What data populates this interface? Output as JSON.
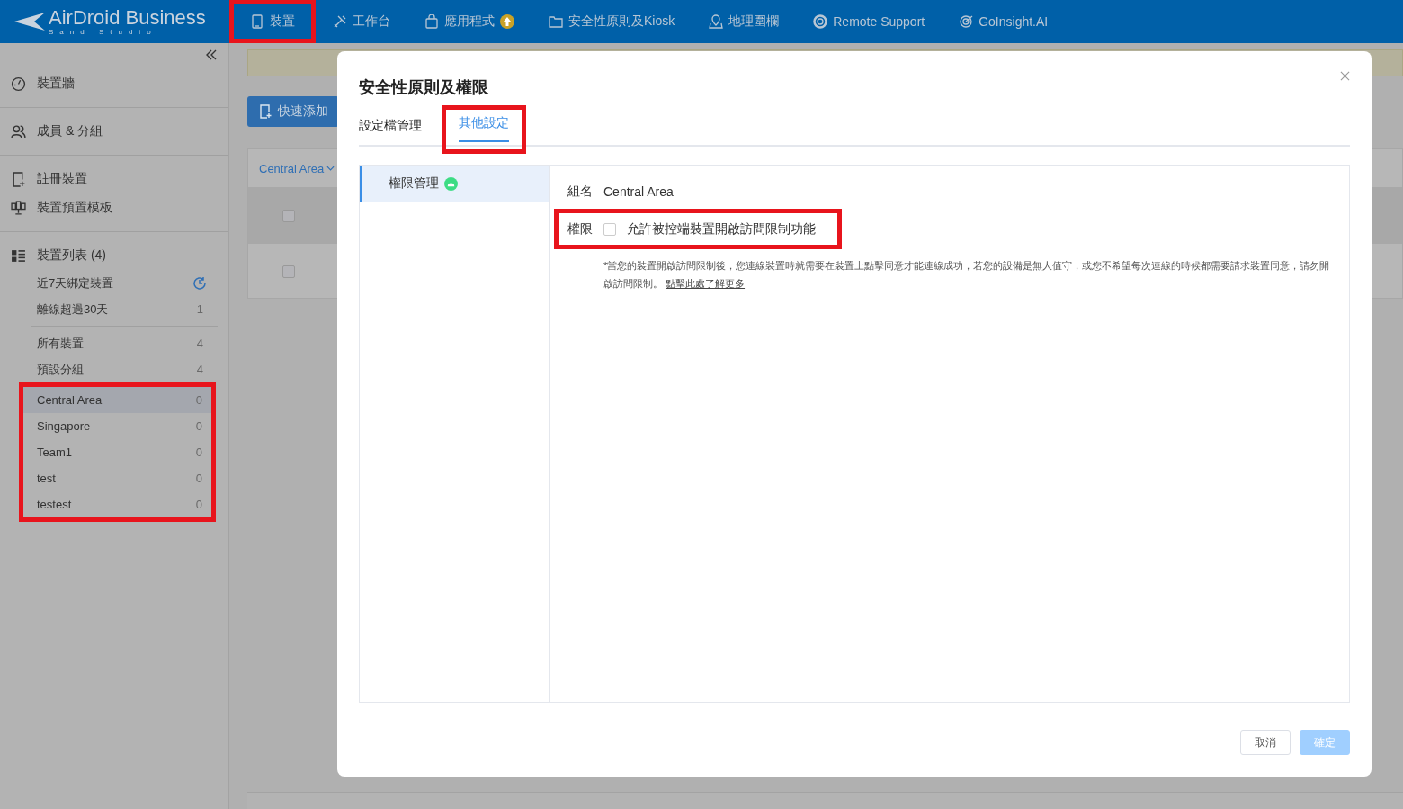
{
  "nav": {
    "logo": "AirDroid Business",
    "logo_sub": "Sand Studio",
    "items": [
      {
        "label": "裝置",
        "highlighted": true
      },
      {
        "label": "工作台",
        "highlighted": false
      },
      {
        "label": "應用程式",
        "badge": true,
        "highlighted": false
      },
      {
        "label": "安全性原則及Kiosk",
        "highlighted": false
      },
      {
        "label": "地理圍欄",
        "highlighted": false
      },
      {
        "label": "Remote Support",
        "highlighted": false
      },
      {
        "label": "GoInsight.AI",
        "highlighted": false
      }
    ]
  },
  "sidebar": {
    "sections": [
      [
        {
          "label": "裝置牆"
        }
      ],
      [
        {
          "label": "成員 & 分組"
        }
      ],
      [
        {
          "label": "註冊裝置"
        },
        {
          "label": "裝置預置模板"
        }
      ]
    ],
    "device_list": {
      "label": "裝置列表 (4)",
      "filters": [
        {
          "label": "近7天綁定裝置",
          "kind": "icon"
        },
        {
          "label": "離線超過30天",
          "kind": "count",
          "count": "1"
        }
      ],
      "all": [
        {
          "label": "所有裝置",
          "count": "4"
        },
        {
          "label": "預設分組",
          "count": "4"
        }
      ],
      "groups_highlighted": true,
      "groups": [
        {
          "label": "Central Area",
          "count": "0",
          "selected": true
        },
        {
          "label": "Singapore",
          "count": "0",
          "selected": false
        },
        {
          "label": "Team1",
          "count": "0",
          "selected": false
        },
        {
          "label": "test",
          "count": "0",
          "selected": false
        },
        {
          "label": "testest",
          "count": "0",
          "selected": false
        }
      ]
    }
  },
  "main": {
    "quick_add": "快速添加",
    "group_filter": "Central Area",
    "rows": [
      {
        "checked": false
      },
      {
        "checked": false
      }
    ]
  },
  "dialog": {
    "title": "安全性原則及權限",
    "tabs": [
      {
        "label": "設定檔管理",
        "selected": false,
        "highlighted": false
      },
      {
        "label": "其他設定",
        "selected": true,
        "highlighted": true
      }
    ],
    "menu": [
      {
        "label": "權限管理",
        "selected": true
      }
    ],
    "group_label": "組名",
    "group_value": "Central Area",
    "permission": {
      "label": "權限",
      "checked": false,
      "text": "允許被控端裝置開啟訪問限制功能",
      "highlighted": true
    },
    "note": "*當您的裝置開啟訪問限制後，您連線裝置時就需要在裝置上點擊同意才能連線成功，若您的設備是無人值守，或您不希望每次連線的時候都需要請求裝置同意，請勿開啟訪問限制。",
    "note_link": "點擊此處了解更多",
    "buttons": [
      {
        "label": "取消",
        "kind": "plain"
      },
      {
        "label": "確定",
        "kind": "primary"
      }
    ]
  }
}
